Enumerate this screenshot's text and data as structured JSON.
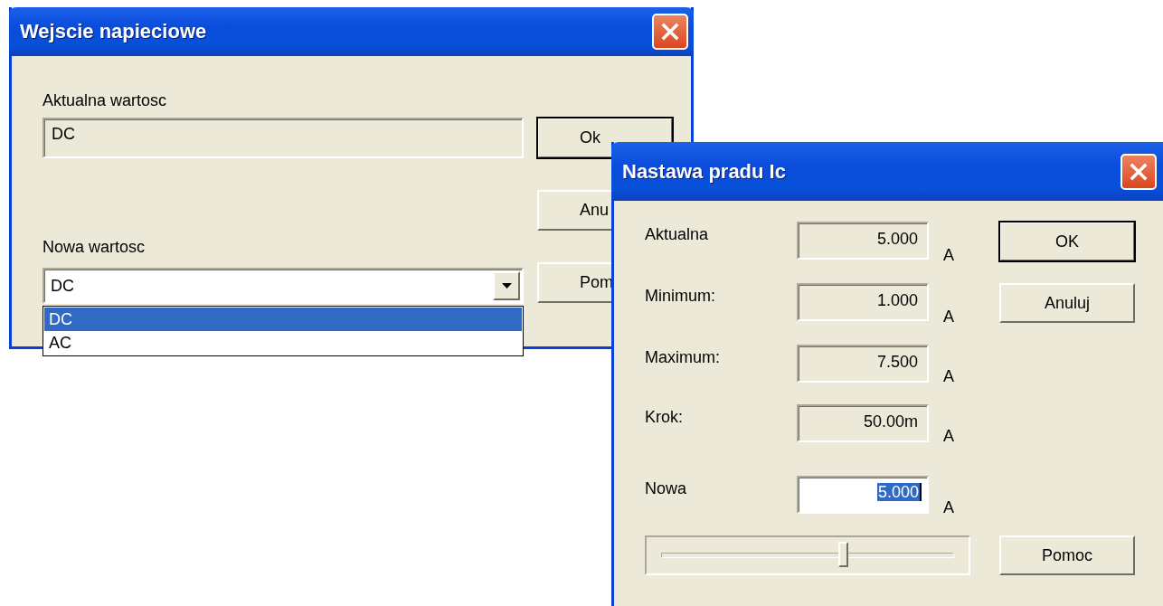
{
  "windows": [
    {
      "kind": "selector",
      "title": "Wejscie napieciowe",
      "current_label": "Aktualna wartosc",
      "current_value": "DC",
      "new_label": "Nowa wartosc",
      "new_value": "DC",
      "dropdown": {
        "expanded": true,
        "options": [
          {
            "label": "DC",
            "selected": true
          },
          {
            "label": "AC",
            "selected": false
          }
        ]
      },
      "buttons": [
        {
          "label": "Ok",
          "default": true
        },
        {
          "label": "Anu",
          "default": false
        },
        {
          "label": "Pom",
          "default": false
        }
      ]
    },
    {
      "kind": "setpoint",
      "title": "Nastawa pradu Ic",
      "rows": [
        {
          "label": "Aktualna",
          "value": "5.000",
          "unit": "A"
        },
        {
          "label": "Minimum:",
          "value": "1.000",
          "unit": "A"
        },
        {
          "label": "Maximum:",
          "value": "7.500",
          "unit": "A"
        },
        {
          "label": "Krok:",
          "value": "50.00m",
          "unit": "A"
        }
      ],
      "new": {
        "label": "Nowa",
        "value": "5.000",
        "unit": "A",
        "text_selected": true
      },
      "slider": {
        "level": 0.62
      },
      "buttons": [
        {
          "label": "OK",
          "default": true
        },
        {
          "label": "Anuluj",
          "default": false
        },
        {
          "label": "Pomoc",
          "default": false
        }
      ]
    }
  ]
}
